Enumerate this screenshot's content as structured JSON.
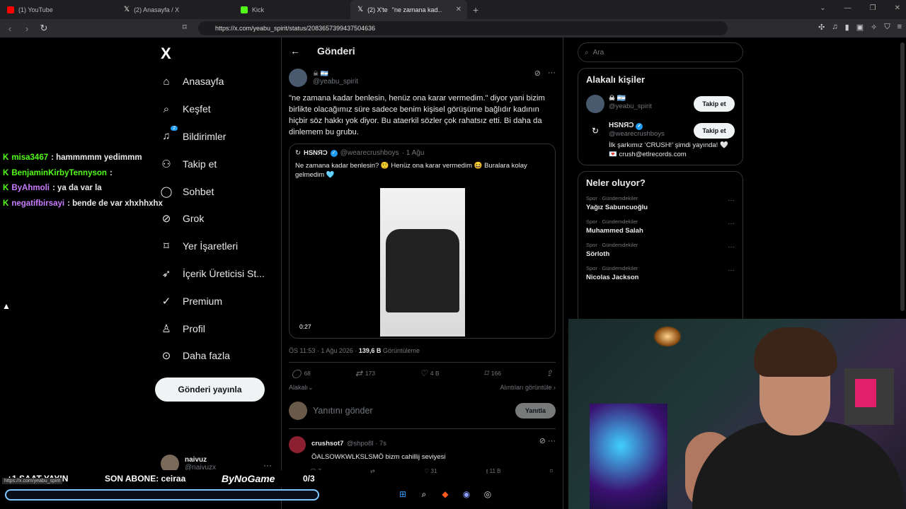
{
  "tabs": [
    {
      "title": "(1) YouTube",
      "color": "#ff0000"
    },
    {
      "title": "(2) Anasayfa / X",
      "color": "#ffffff"
    },
    {
      "title": "Kick",
      "color": "#53fc18"
    },
    {
      "title": "(2) X'te ",
      "title2": "\"ne zamana kad…",
      "color": "#ffffff",
      "active": true
    }
  ],
  "address": {
    "url": "https://x.com/yeabu_spirit/status/2083657399437504636"
  },
  "sidebar": {
    "logo": "X",
    "items": [
      {
        "label": "Anasayfa",
        "icon": "home-icon"
      },
      {
        "label": "Keşfet",
        "icon": "search-icon"
      },
      {
        "label": "Bildirimler",
        "icon": "bell-icon",
        "badge": "2"
      },
      {
        "label": "Takip et",
        "icon": "person-add-icon"
      },
      {
        "label": "Sohbet",
        "icon": "chat-icon"
      },
      {
        "label": "Grok",
        "icon": "grok-icon"
      },
      {
        "label": "Yer İşaretleri",
        "icon": "bookmark-icon"
      },
      {
        "label": "İçerik Üreticisi St...",
        "icon": "rocket-icon"
      },
      {
        "label": "Premium",
        "icon": "check-circle-icon"
      },
      {
        "label": "Profil",
        "icon": "person-icon"
      },
      {
        "label": "Daha fazla",
        "icon": "more-icon"
      }
    ],
    "post_button": "Gönderi yayınla",
    "me": {
      "name": "naivuz",
      "handle": "@naivuzx"
    }
  },
  "main": {
    "header": "Gönderi",
    "tweet": {
      "flags": "☠ 🇦🇷",
      "handle": "@yeabu_spirit",
      "text": "\"ne zamana kadar benlesin, henüz ona karar vermedim.\" diyor yani bizim birlikte olacağımız süre sadece benim kişisel görüşüme bağlıdır kadının hiçbir söz hakkı yok diyor. Bu ataerkil sözler çok rahatsız etti. Bi daha da dinlemem bu grubu.",
      "quote": {
        "name": "HSNЯƆ",
        "handle": "@wearecrushboys",
        "date": "· 1 Ağu",
        "text": "Ne zamana kadar benlesin? 🤨 Henüz ona karar vermedim 😆 Buralara kolay gelmedim 🩵",
        "duration": "0:27"
      },
      "meta_time": "ÖS 11:53 · 1 Ağu 2026 · ",
      "views": "139,6 B",
      "views_label": " Görüntüleme",
      "actions": {
        "replies": "68",
        "reposts": "173",
        "likes": "4 B",
        "bookmarks": "166"
      },
      "relevant": "Alakalı",
      "quotes_link": "Alıntıları görüntüle"
    },
    "reply_placeholder": "Yanıtını gönder",
    "reply_button": "Yanıtla",
    "comment": {
      "name": "crushsot7",
      "handle": "@shpo8l · 7s",
      "text": "ÖALSOWKWLKSLSMÖ bizm cahillij seviyesi",
      "replies": "7",
      "likes": "31",
      "views": "11 B"
    }
  },
  "right": {
    "search_placeholder": "Ara",
    "people_title": "Alakalı kişiler",
    "people": [
      {
        "name": "☠ 🇦🇷",
        "handle": "@yeabu_spirit",
        "follow": "Takip et",
        "bio": ""
      },
      {
        "name": "HSNЯƆ",
        "handle": "@wearecrushboys",
        "follow": "Takip et",
        "bio": "İlk şarkımız ‘CRUSH!’ şimdi yayında! 🤍 💌 crush@etlrecords.com"
      }
    ],
    "trends_title": "Neler oluyor?",
    "trends": [
      {
        "category": "Spor · Gündemdekiler",
        "name": "Yağız Sabuncuoğlu"
      },
      {
        "category": "Spor · Gündemdekiler",
        "name": "Muhammed Salah"
      },
      {
        "category": "Spor · Gündemdekiler",
        "name": "Sörloth"
      },
      {
        "category": "Spor · Gündemdekiler",
        "name": "Nicolas Jackson"
      }
    ]
  },
  "chat": [
    {
      "user": "misa3467",
      "color": "#53fc18",
      "msg": ": hammmmm yedimmm"
    },
    {
      "user": "BenjaminKirbyTennyson",
      "color": "#53fc18",
      "msg": ":"
    },
    {
      "user": "ByAhmoli",
      "color": "#c97cff",
      "msg": ": ya da var la"
    },
    {
      "user": "negatifbirsayi",
      "color": "#c97cff",
      "msg": ": bende de var xhxhhxhx"
    }
  ],
  "overlay": {
    "left": "+1 SAAT YAYIN",
    "sub_label": "SON ABONE: ceiraa",
    "brand": "ByNoGame",
    "counter": "0/3",
    "status_url": "https://x.com/yeabu_spirit"
  }
}
